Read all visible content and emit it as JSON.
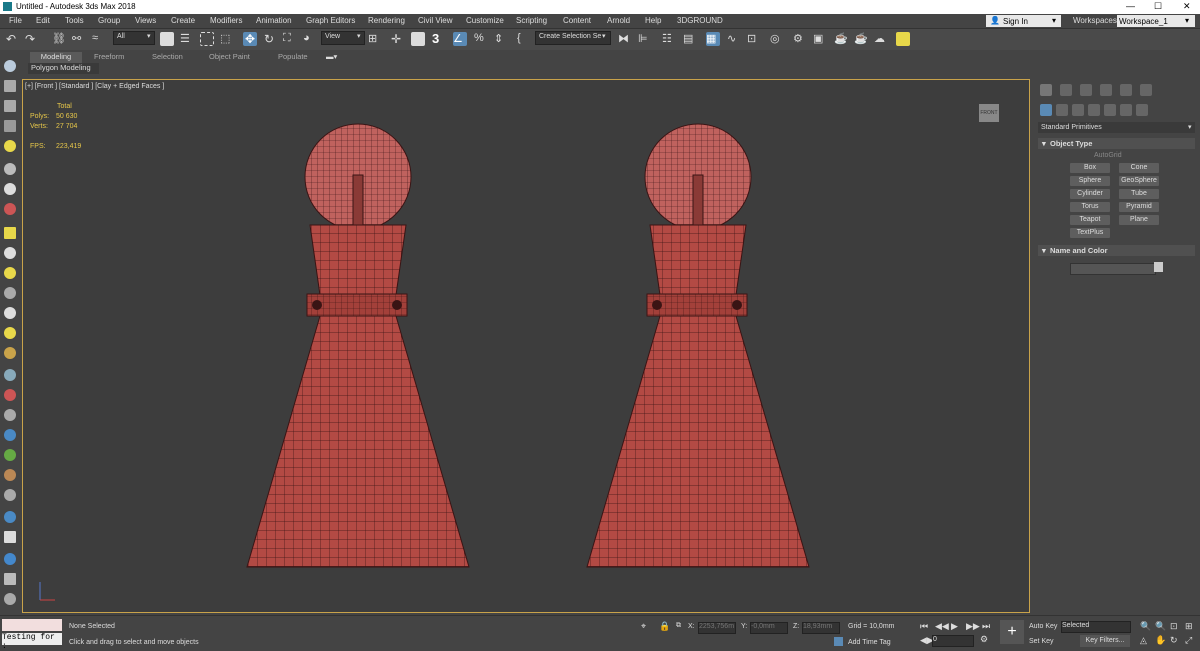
{
  "window": {
    "title": "Untitled - Autodesk 3ds Max 2018",
    "controls": [
      "—",
      "☐",
      "✕"
    ]
  },
  "menu": [
    "File",
    "Edit",
    "Tools",
    "Group",
    "Views",
    "Create",
    "Modifiers",
    "Animation",
    "Graph Editors",
    "Rendering",
    "Civil View",
    "Customize",
    "Scripting",
    "Content",
    "Arnold",
    "Help",
    "3DGROUND"
  ],
  "account": {
    "sign_in": "Sign In",
    "workspaces_label": "Workspaces:",
    "workspace": "Workspace_1"
  },
  "toolbar": {
    "filter": "All",
    "ref_coord": "View",
    "snap_value": "3",
    "selection_set": "Create Selection Se"
  },
  "ribbon": {
    "tabs": [
      "Modeling",
      "Freeform",
      "Selection",
      "Object Paint",
      "Populate"
    ],
    "sub": "Polygon Modeling"
  },
  "viewport": {
    "label": "[+] [Front ] [Standard ] [Clay + Edged Faces ]",
    "stats": {
      "total_label": "Total",
      "polys_label": "Polys:",
      "polys": "50 630",
      "verts_label": "Verts:",
      "verts": "27 704",
      "fps_label": "FPS:",
      "fps": "223,419"
    },
    "viewcube": "FRONT"
  },
  "command_panel": {
    "category": "Standard Primitives",
    "object_type": "Object Type",
    "autogrid": "AutoGrid",
    "primitives": [
      "Box",
      "Cone",
      "Sphere",
      "GeoSphere",
      "Cylinder",
      "Tube",
      "Torus",
      "Pyramid",
      "Teapot",
      "Plane",
      "TextPlus"
    ],
    "name_and_color": "Name and Color"
  },
  "status": {
    "selection": "None Selected",
    "prompt": "Click and drag to select and move objects",
    "maxscript": "Testing for :",
    "x_label": "X:",
    "x": "2253,756m",
    "y_label": "Y:",
    "y": "-0,0mm",
    "z_label": "Z:",
    "z": "18,93mm",
    "grid": "Grid = 10,0mm",
    "add_time_tag": "Add Time Tag",
    "frame": "0",
    "auto_key": "Auto Key",
    "set_key": "Set Key",
    "key_mode": "Selected",
    "key_filters": "Key Filters..."
  },
  "colors": {
    "accent": "#5a8ab5",
    "viewport_border": "#c9a34a",
    "model": "#b34a44",
    "stats": "#e8c84a"
  }
}
